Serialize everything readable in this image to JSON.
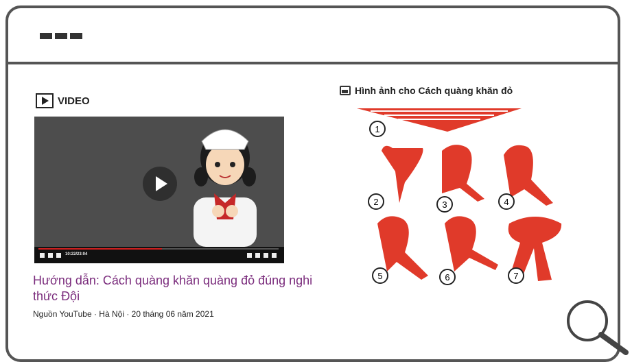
{
  "header": {
    "menu_icon": "three-dash-menu-icon"
  },
  "video": {
    "label": "VIDEO",
    "time": "10:22/23:04",
    "title": "Hướng dẫn: Cách quàng khăn quàng đỏ đúng nghi thức Đội",
    "source": "Nguồn YouTube · Hà Nội · 20 tháng 06 năm 2021"
  },
  "images": {
    "label": "Hình ảnh cho Cách quàng khăn đỏ",
    "steps": [
      "1",
      "2",
      "3",
      "4",
      "5",
      "6",
      "7"
    ]
  },
  "colors": {
    "scarf_red": "#e03a2a",
    "title_purple": "#7b2d7d",
    "frame_gray": "#555555"
  }
}
